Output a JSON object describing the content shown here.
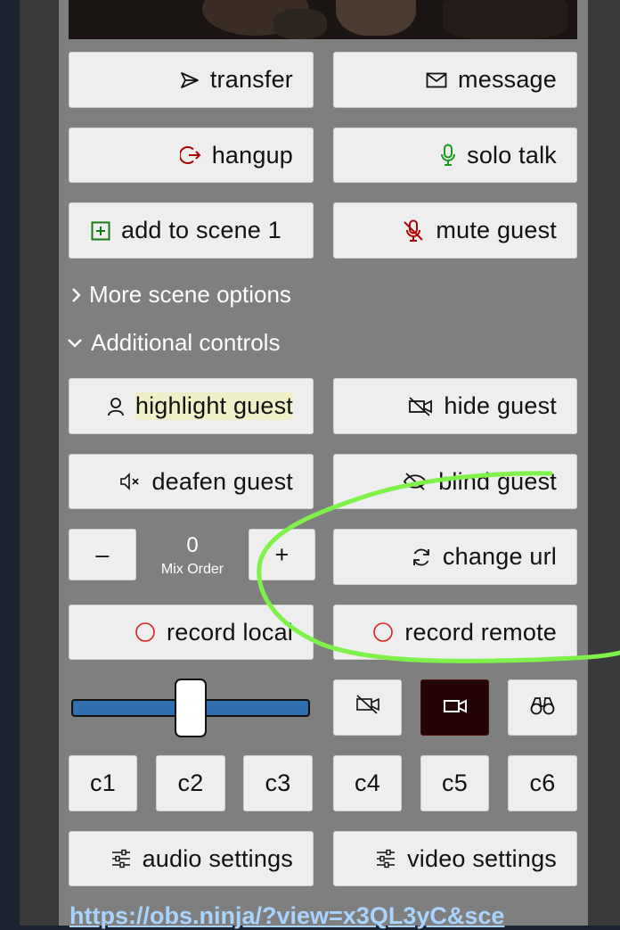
{
  "buttons": {
    "transfer": "transfer",
    "message": "message",
    "hangup": "hangup",
    "solo_talk": "solo talk",
    "add_to_scene": "add to scene 1",
    "mute_guest": "mute guest",
    "highlight_guest": "highlight guest",
    "hide_guest": "hide guest",
    "deafen_guest": "deafen guest",
    "blind_guest": "blind guest",
    "mix_minus": "–",
    "mix_plus": "+",
    "change_url": "change url",
    "record_local": "record local",
    "record_remote": "record remote",
    "audio_settings": "audio settings",
    "video_settings": "video settings"
  },
  "sections": {
    "more_scene_options": "More scene options",
    "additional_controls": "Additional controls"
  },
  "mix_order": {
    "value": "0",
    "label": "Mix Order"
  },
  "volume": {
    "level": 0.5
  },
  "scene_buttons": [
    "c1",
    "c2",
    "c3",
    "c4",
    "c5",
    "c6"
  ],
  "link": {
    "text": "https://obs.ninja/?view=x3QL3yC&sce"
  },
  "colors": {
    "panel": "#7f7f7f",
    "button": "#eeeeee",
    "hangup_icon": "#b00000",
    "solo_icon": "#1a9a1a",
    "add_icon": "#157a15",
    "mute_icon": "#b00000",
    "record_icon": "#e02020",
    "slider": "#2f6fb0",
    "annotation": "#7ef24a",
    "link": "#a8d4ff"
  },
  "icons": {
    "transfer": "paper-plane-icon",
    "message": "envelope-icon",
    "hangup": "sign-out-icon",
    "solo_talk": "microphone-icon",
    "add_to_scene": "plus-square-icon",
    "mute_guest": "microphone-slash-icon",
    "highlight_guest": "user-icon",
    "hide_guest": "video-slash-icon",
    "deafen_guest": "volume-mute-icon",
    "blind_guest": "eye-slash-icon",
    "change_url": "sync-icon",
    "record": "circle-icon",
    "video_off": "video-slash-icon",
    "video_on": "video-icon",
    "binoculars": "binoculars-icon",
    "settings": "sliders-icon"
  }
}
